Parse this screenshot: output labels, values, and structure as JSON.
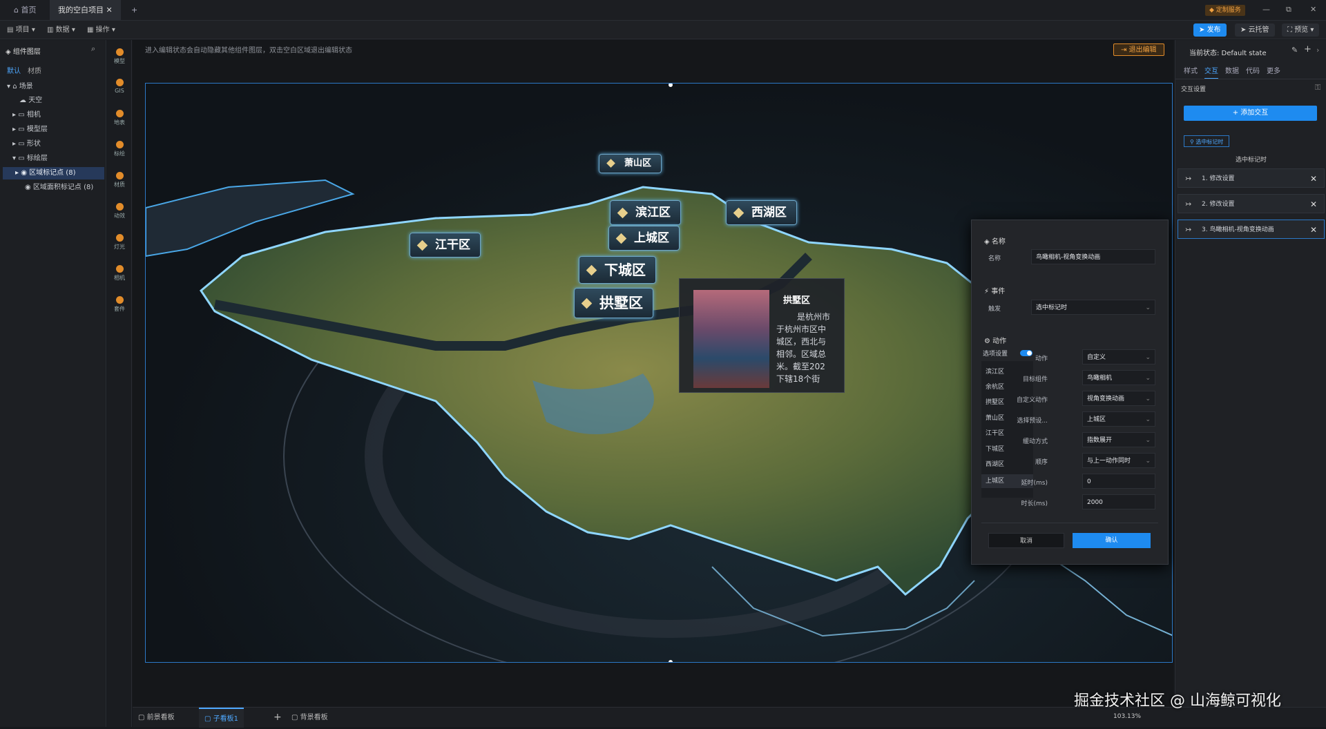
{
  "titlebar": {
    "home_tab": "首页",
    "project_tab": "我的空白项目",
    "new_tab": "+",
    "service_badge": "定制服务",
    "window_min": "—",
    "window_max": "⧉",
    "window_close": "✕"
  },
  "toolbar": {
    "menu_project": "项目",
    "menu_data": "数据",
    "menu_ops": "操作",
    "publish": "发布",
    "cloud": "云托管",
    "preview": "预览"
  },
  "left_panel": {
    "title": "组件图层",
    "tabs": [
      "默认",
      "材质"
    ],
    "tree": [
      {
        "label": "场景",
        "level": 0
      },
      {
        "label": "天空",
        "level": 1
      },
      {
        "label": "相机",
        "level": 1
      },
      {
        "label": "模型层",
        "level": 1
      },
      {
        "label": "形状",
        "level": 1
      },
      {
        "label": "标绘层",
        "level": 1
      },
      {
        "label": "区域标记点 (8)",
        "level": 2
      },
      {
        "label": "区域面积标记点 (8)",
        "level": 2
      }
    ]
  },
  "icon_strip": [
    "模型",
    "GIS",
    "地表",
    "标绘",
    "材质",
    "动效",
    "灯光",
    "相机",
    "套件"
  ],
  "canvas": {
    "hint": "进入编辑状态会自动隐藏其他组件图层，双击空白区域退出编辑状态",
    "exit_edit": "退出编辑",
    "districts": [
      "萧山区",
      "滨江区",
      "西湖区",
      "上城区",
      "江干区",
      "下城区",
      "拱墅区"
    ],
    "info_title": "拱墅区",
    "info_lines": [
      "是杭州市",
      "于杭州市区中",
      "城区，西北与",
      "相邻。区域总",
      "米。截至202",
      "下辖18个街"
    ]
  },
  "dialog": {
    "section_name": "名称",
    "name_label": "名称",
    "name_value": "鸟瞰相机-视角变换动画",
    "section_event": "事件",
    "trigger_label": "触发",
    "trigger_value": "选中标记时",
    "section_action": "动作",
    "option_toggle_label": "选项设置",
    "options": [
      "滨江区",
      "余杭区",
      "拱墅区",
      "萧山区",
      "江干区",
      "下城区",
      "西湖区",
      "上城区"
    ],
    "fields": [
      {
        "label": "动作",
        "value": "自定义"
      },
      {
        "label": "目标组件",
        "value": "鸟瞰相机"
      },
      {
        "label": "自定义动作",
        "value": "视角变换动画"
      },
      {
        "label": "选择预设...",
        "value": "上城区"
      },
      {
        "label": "缓动方式",
        "value": "指数展开"
      },
      {
        "label": "顺序",
        "value": "与上一动作同时"
      },
      {
        "label": "延时(ms)",
        "value": "0"
      },
      {
        "label": "时长(ms)",
        "value": "2000"
      }
    ],
    "cancel": "取消",
    "confirm": "确认"
  },
  "right_panel": {
    "state_label": "当前状态: Default state",
    "tabs": [
      "样式",
      "交互",
      "数据",
      "代码",
      "更多"
    ],
    "section": "交互设置",
    "add_button": "+ 添加交互",
    "trigger_chip": "选中标记时",
    "trigger_heading": "选中标记时",
    "items": [
      "1. 修改设置",
      "2. 修改设置",
      "3. 鸟瞰相机-视角变换动画"
    ]
  },
  "bottom_bar": {
    "tabs": [
      "前景看板",
      "子看板1",
      "背景看板"
    ],
    "zoom": "103.13%"
  },
  "watermark": "掘金技术社区 @ 山海鲸可视化",
  "colors": {
    "accent": "#1e8bf0",
    "warning": "#e28c2a",
    "selection": "#26395a"
  }
}
